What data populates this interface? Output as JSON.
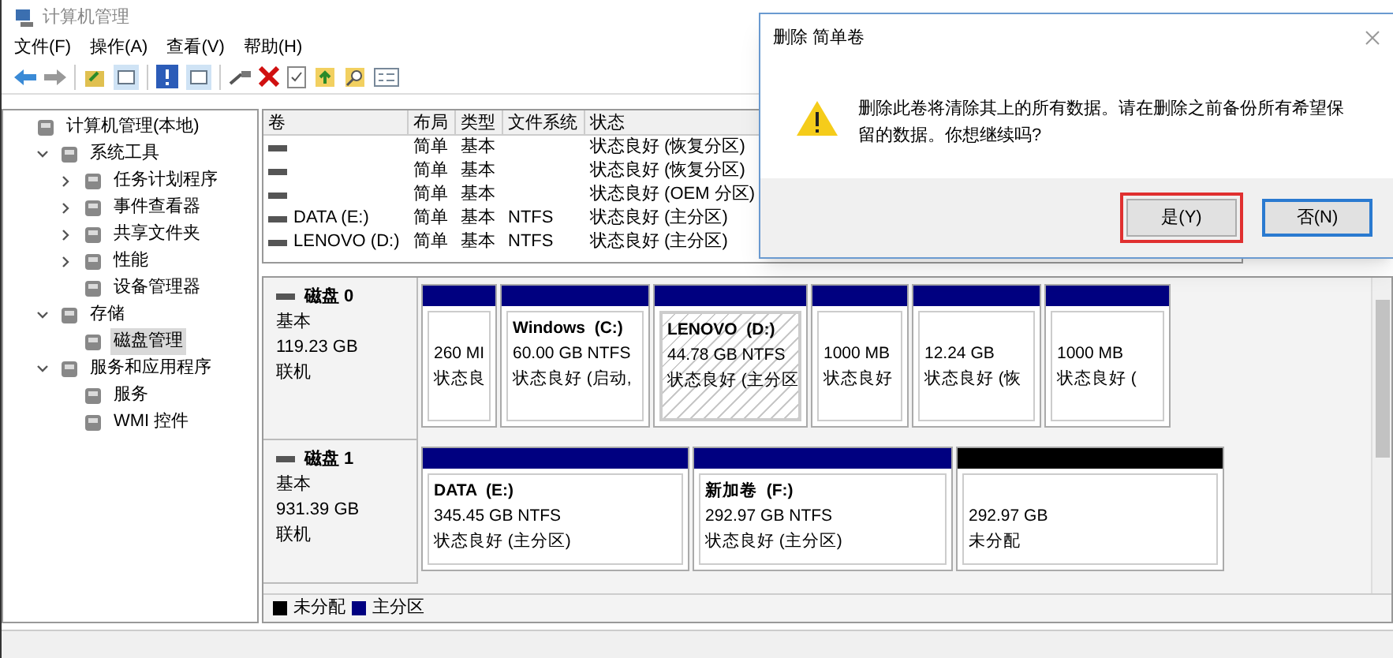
{
  "window": {
    "title": "计算机管理"
  },
  "menu": [
    "文件(F)",
    "操作(A)",
    "查看(V)",
    "帮助(H)"
  ],
  "tree": [
    {
      "label": "计算机管理(本地)",
      "selected": false,
      "children": [
        {
          "label": "系统工具",
          "expanded": true,
          "selected": false,
          "children": [
            {
              "label": "任务计划程序",
              "expanded": false,
              "selected": false
            },
            {
              "label": "事件查看器",
              "expanded": false,
              "selected": false
            },
            {
              "label": "共享文件夹",
              "expanded": false,
              "selected": false
            },
            {
              "label": "性能",
              "expanded": false,
              "selected": false
            },
            {
              "label": "设备管理器",
              "selected": false
            }
          ]
        },
        {
          "label": "存储",
          "expanded": true,
          "selected": false,
          "children": [
            {
              "label": "磁盘管理",
              "selected": true
            }
          ]
        },
        {
          "label": "服务和应用程序",
          "expanded": true,
          "selected": false,
          "children": [
            {
              "label": "服务",
              "selected": false
            },
            {
              "label": "WMI 控件",
              "selected": false
            }
          ]
        }
      ]
    }
  ],
  "table": {
    "columns": [
      "卷",
      "布局",
      "类型",
      "文件系统",
      "状态"
    ],
    "rows": [
      {
        "cells": [
          "",
          "简单",
          "基本",
          "",
          "状态良好 (恢复分区)"
        ]
      },
      {
        "cells": [
          "",
          "简单",
          "基本",
          "",
          "状态良好 (恢复分区)"
        ]
      },
      {
        "cells": [
          "",
          "简单",
          "基本",
          "",
          "状态良好 (OEM 分区)"
        ]
      },
      {
        "cells": [
          "DATA (E:)",
          "简单",
          "基本",
          "NTFS",
          "状态良好 (主分区)"
        ]
      },
      {
        "cells": [
          "LENOVO (D:)",
          "简单",
          "基本",
          "NTFS",
          "状态良好 (主分区)"
        ]
      }
    ]
  },
  "disks": [
    {
      "name": "磁盘 0",
      "type": "基本",
      "size": "119.23 GB",
      "status": "联机",
      "partitions": [
        {
          "kind": "primary",
          "selected": false,
          "size": "260 MI",
          "status": "状态良"
        },
        {
          "kind": "primary",
          "selected": false,
          "name": "Windows  (C:)",
          "size": "60.00 GB NTFS",
          "status": "状态良好 (启动,"
        },
        {
          "kind": "primary",
          "selected": true,
          "name": "LENOVO  (D:)",
          "size": "44.78 GB NTFS",
          "status": "状态良好 (主分区"
        },
        {
          "kind": "primary",
          "selected": false,
          "size": "1000 MB",
          "status": "状态良好"
        },
        {
          "kind": "primary",
          "selected": false,
          "size": "12.24 GB",
          "status": "状态良好 (恢"
        },
        {
          "kind": "primary",
          "selected": false,
          "size": "1000 MB",
          "status": "状态良好 ("
        }
      ]
    },
    {
      "name": "磁盘 1",
      "type": "基本",
      "size": "931.39 GB",
      "status": "联机",
      "partitions": [
        {
          "kind": "primary",
          "selected": false,
          "name": "DATA  (E:)",
          "size": "345.45 GB NTFS",
          "status": "状态良好 (主分区)"
        },
        {
          "kind": "primary",
          "selected": false,
          "name": "新加卷  (F:)",
          "size": "292.97 GB NTFS",
          "status": "状态良好 (主分区)"
        },
        {
          "kind": "unallocated",
          "selected": false,
          "size": "292.97 GB",
          "status": "未分配"
        }
      ]
    }
  ],
  "legend": [
    {
      "label": "未分配",
      "color": "#000000"
    },
    {
      "label": "主分区",
      "color": "#000080"
    }
  ],
  "dialog": {
    "title": "删除 简单卷",
    "message": "删除此卷将清除其上的所有数据。请在删除之前备份所有希望保留的数据。你想继续吗?",
    "buttons": [
      {
        "label": "是(Y)",
        "highlighted": true,
        "default": false
      },
      {
        "label": "否(N)",
        "highlighted": false,
        "default": true
      }
    ]
  }
}
